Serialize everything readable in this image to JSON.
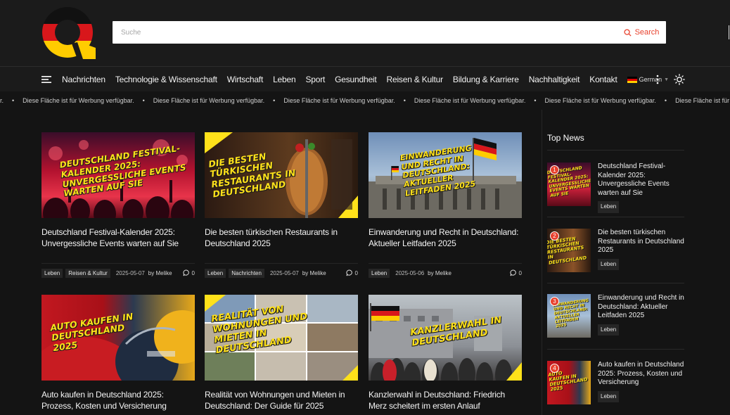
{
  "search": {
    "placeholder": "Suche",
    "button_label": "Search"
  },
  "nav": {
    "items": [
      "Nachrichten",
      "Technologie & Wissenschaft",
      "Wirtschaft",
      "Leben",
      "Sport",
      "Gesundheit",
      "Reisen & Kultur",
      "Bildung & Karriere",
      "Nachhaltigkeit",
      "Kontakt"
    ],
    "language": "German"
  },
  "ticker": {
    "lead": "r.",
    "message": "Diese Fläche ist für Werbung verfügbar."
  },
  "articles": [
    {
      "title": "Deutschland Festival-Kalender 2025: Unvergessliche Events warten auf Sie",
      "thumb_text": "Deutschland Festival-Kalender 2025: Unvergessliche Events warten auf Sie",
      "tags": [
        "Leben",
        "Reisen & Kultur"
      ],
      "date": "2025-05-07",
      "author": "by Melike",
      "comments": "0"
    },
    {
      "title": "Die besten türkischen Restaurants in Deutschland 2025",
      "thumb_text": "Die besten türkischen Restaurants in Deutschland",
      "tags": [
        "Leben",
        "Nachrichten"
      ],
      "date": "2025-05-07",
      "author": "by Melike",
      "comments": "0"
    },
    {
      "title": "Einwanderung und Recht in Deutschland: Aktueller Leitfaden 2025",
      "thumb_text": "Einwanderung und Recht in Deutschland: Aktueller Leitfaden 2025",
      "tags": [
        "Leben"
      ],
      "date": "2025-05-06",
      "author": "by Melike",
      "comments": "0"
    },
    {
      "title": "Auto kaufen in Deutschland 2025: Prozess, Kosten und Versicherung",
      "thumb_text": "Auto kaufen in Deutschland 2025"
    },
    {
      "title": "Realität von Wohnungen und Mieten in Deutschland: Der Guide für 2025",
      "thumb_text": "Realität von Wohnungen und Mieten in Deutschland"
    },
    {
      "title": "Kanzlerwahl in Deutschland: Friedrich Merz scheitert im ersten Anlauf",
      "thumb_text": "Kanzlerwahl in Deutschland"
    }
  ],
  "sidebar": {
    "title": "Top News",
    "items": [
      {
        "num": "1",
        "title": "Deutschland Festival-Kalender 2025: Unvergessliche Events warten auf Sie",
        "tag": "Leben",
        "thumb_text": "Deutschland Festival-Kalender 2025: Unvergessliche Events warten auf Sie"
      },
      {
        "num": "2",
        "title": "Die besten türkischen Restaurants in Deutschland 2025",
        "tag": "Leben",
        "thumb_text": "Die besten türkischen Restaurants in Deutschland"
      },
      {
        "num": "3",
        "title": "Einwanderung und Recht in Deutschland: Aktueller Leitfaden 2025",
        "tag": "Leben",
        "thumb_text": "Einwanderung und Recht in Deutschland: Aktueller Leitfaden 2025"
      },
      {
        "num": "4",
        "title": "Auto kaufen in Deutschland 2025: Prozess, Kosten und Versicherung",
        "tag": "Leben",
        "thumb_text": "Auto kaufen in Deutschland 2025"
      }
    ]
  },
  "colors": {
    "accent": "#e8412d",
    "headline_yellow": "#ffe11a",
    "background": "#141414",
    "header": "#1b1b1b"
  }
}
